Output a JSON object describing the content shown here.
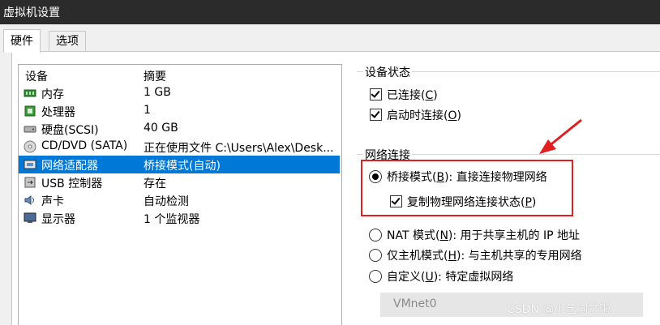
{
  "window": {
    "title": "虚拟机设置"
  },
  "tabs": [
    {
      "label": "硬件"
    },
    {
      "label": "选项"
    }
  ],
  "device_table": {
    "columns": [
      "设备",
      "摘要"
    ],
    "rows": [
      {
        "device": "内存",
        "summary": "1 GB",
        "icon": "memory-icon"
      },
      {
        "device": "处理器",
        "summary": "1",
        "icon": "cpu-icon"
      },
      {
        "device": "硬盘(SCSI)",
        "summary": "40 GB",
        "icon": "harddisk-icon"
      },
      {
        "device": "CD/DVD (SATA)",
        "summary": "正在使用文件 C:\\Users\\Alex\\Desk...",
        "icon": "cd-dvd-icon"
      },
      {
        "device": "网络适配器",
        "summary": "桥接模式(自动)",
        "icon": "network-adapter-icon",
        "selected": true
      },
      {
        "device": "USB 控制器",
        "summary": "存在",
        "icon": "usb-icon"
      },
      {
        "device": "声卡",
        "summary": "自动检测",
        "icon": "sound-card-icon"
      },
      {
        "device": "显示器",
        "summary": "1 个监视器",
        "icon": "monitor-icon"
      }
    ]
  },
  "device_status": {
    "title": "设备状态",
    "connected": {
      "label_pre": "已连接(",
      "key": "C",
      "label_post": ")"
    },
    "connect_on_start": {
      "label_pre": "启动时连接(",
      "key": "O",
      "label_post": ")"
    }
  },
  "network": {
    "title": "网络连接",
    "bridged": {
      "pre": "桥接模式(",
      "key": "B",
      "post": "): 直接连接物理网络"
    },
    "replicate": {
      "pre": "复制物理网络连接状态(",
      "key": "P",
      "post": ")"
    },
    "nat": {
      "pre": "NAT 模式(",
      "key": "N",
      "post": "): 用于共享主机的 IP 地址"
    },
    "host_only": {
      "pre": "仅主机模式(",
      "key": "H",
      "post": "): 与主机共享的专用网络"
    },
    "custom": {
      "pre": "自定义(",
      "key": "U",
      "post": "): 特定虚拟网络"
    },
    "vmnet_value": "VMnet0"
  },
  "watermark": "CSDN @小艺同学啦",
  "colors": {
    "selection": "#0078d7",
    "highlight_box": "#e02020"
  }
}
